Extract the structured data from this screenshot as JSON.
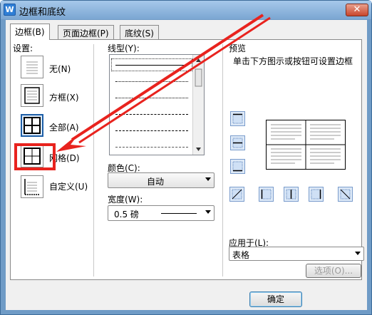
{
  "window": {
    "title": "边框和底纹",
    "app_icon_letter": "W",
    "close_glyph": "✕"
  },
  "tabs": [
    {
      "label": "边框(B)",
      "active": true
    },
    {
      "label": "页面边框(P)",
      "active": false
    },
    {
      "label": "底纹(S)",
      "active": false
    }
  ],
  "settings": {
    "heading": "设置:",
    "items": [
      {
        "label": "无(N)",
        "icon": "none-border-icon"
      },
      {
        "label": "方框(X)",
        "icon": "box-border-icon"
      },
      {
        "label": "全部(A)",
        "icon": "all-borders-icon",
        "selected": true
      },
      {
        "label": "网格(D)",
        "icon": "grid-border-icon"
      },
      {
        "label": "自定义(U)",
        "icon": "custom-border-icon"
      }
    ]
  },
  "line_style": {
    "label": "线型(Y):"
  },
  "color": {
    "label": "颜色(C):",
    "value": "自动"
  },
  "width": {
    "label": "宽度(W):",
    "value": "0.5 磅"
  },
  "preview": {
    "label": "预览",
    "hint": "单击下方图示或按钮可设置边框"
  },
  "apply_to": {
    "label": "应用于(L):",
    "value": "表格"
  },
  "buttons": {
    "options": "选项(O)...",
    "ok": "确定"
  },
  "annotation": {
    "color": "#e8231e"
  }
}
